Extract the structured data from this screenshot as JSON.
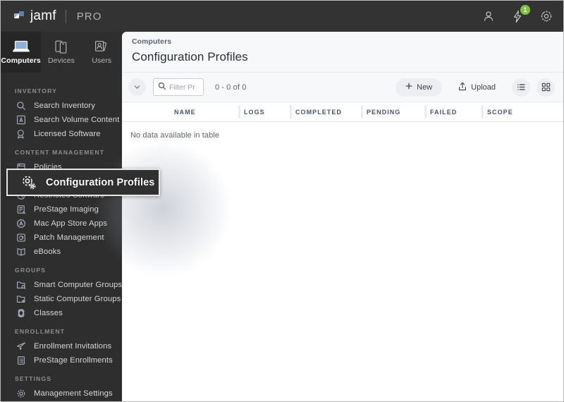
{
  "topbar": {
    "brand": "jamf",
    "product": "PRO",
    "icons": [
      {
        "name": "user-icon",
        "label": "User"
      },
      {
        "name": "bolt-icon",
        "label": "Notifications",
        "badge": "1"
      },
      {
        "name": "gear-icon",
        "label": "Settings"
      }
    ]
  },
  "tabs": [
    {
      "label": "Computers",
      "icon": "laptop-icon",
      "active": true
    },
    {
      "label": "Devices",
      "icon": "mobile-devices-icon",
      "active": false
    },
    {
      "label": "Users",
      "icon": "user-cards-icon",
      "active": false
    }
  ],
  "sidebar": {
    "sections": [
      {
        "title": "INVENTORY",
        "items": [
          {
            "label": "Search Inventory",
            "icon": "search-icon"
          },
          {
            "label": "Search Volume Content",
            "icon": "volume-content-icon"
          },
          {
            "label": "Licensed Software",
            "icon": "license-badge-icon"
          }
        ]
      },
      {
        "title": "CONTENT MANAGEMENT",
        "items": [
          {
            "label": "Policies",
            "icon": "policies-icon"
          },
          {
            "label": "Configuration Profiles",
            "icon": "gears-icon"
          },
          {
            "label": "Restricted Software",
            "icon": "restricted-icon"
          },
          {
            "label": "PreStage Imaging",
            "icon": "prestage-imaging-icon"
          },
          {
            "label": "Mac App Store Apps",
            "icon": "app-store-icon"
          },
          {
            "label": "Patch Management",
            "icon": "patch-icon"
          },
          {
            "label": "eBooks",
            "icon": "ebooks-icon"
          }
        ]
      },
      {
        "title": "GROUPS",
        "items": [
          {
            "label": "Smart Computer Groups",
            "icon": "smart-group-icon"
          },
          {
            "label": "Static Computer Groups",
            "icon": "static-group-icon"
          },
          {
            "label": "Classes",
            "icon": "classes-icon"
          }
        ]
      },
      {
        "title": "ENROLLMENT",
        "items": [
          {
            "label": "Enrollment Invitations",
            "icon": "paper-plane-icon"
          },
          {
            "label": "PreStage Enrollments",
            "icon": "clipboard-icon"
          }
        ]
      },
      {
        "title": "SETTINGS",
        "items": [
          {
            "label": "Management Settings",
            "icon": "gear-icon"
          }
        ]
      }
    ]
  },
  "callout": {
    "label": "Configuration Profiles",
    "icon": "gears-icon"
  },
  "main": {
    "breadcrumb": "Computers",
    "title": "Configuration Profiles",
    "toolbar": {
      "collapse_label": "chevron-down",
      "filter_placeholder": "Filter Pr",
      "filter_value": "",
      "count": "0 - 0 of 0",
      "new_label": "New",
      "upload_label": "Upload",
      "list_view_label": "List view",
      "grid_view_label": "Grid view"
    },
    "table": {
      "columns": [
        "NAME",
        "LOGS",
        "COMPLETED",
        "PENDING",
        "FAILED",
        "SCOPE"
      ],
      "rows": [],
      "empty_message": "No data available in table"
    }
  },
  "colors": {
    "topbar_bg": "#333333",
    "sidebar_bg": "#2e2e2e",
    "accent_badge": "#7fc243",
    "panel_header_bg": "#f7f8fa",
    "callout_bg": "#303030",
    "callout_border": "#e8e8e8"
  }
}
